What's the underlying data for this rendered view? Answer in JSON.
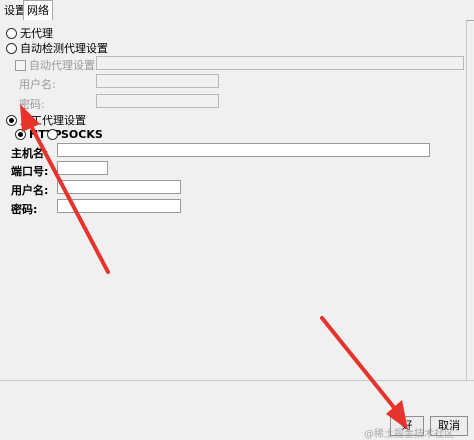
{
  "tabs": [
    "设置",
    "网络"
  ],
  "options": {
    "no_proxy": "无代理",
    "auto_detect": "自动检测代理设置",
    "auto_config_url": "自动代理设置URL:",
    "auto_username": "用户名:",
    "auto_password": "密码:",
    "manual": "人工代理设置",
    "http": "HTTP",
    "socks": "SOCKS",
    "host": "主机名:",
    "port": "端口号:",
    "username": "用户名:",
    "password": "密码:"
  },
  "buttons": {
    "ok": "好",
    "cancel": "取消"
  },
  "watermark": "@稀土掘金技术社区",
  "colors": {
    "arrow": "#e8322c",
    "panel": "#f0f0f0"
  }
}
